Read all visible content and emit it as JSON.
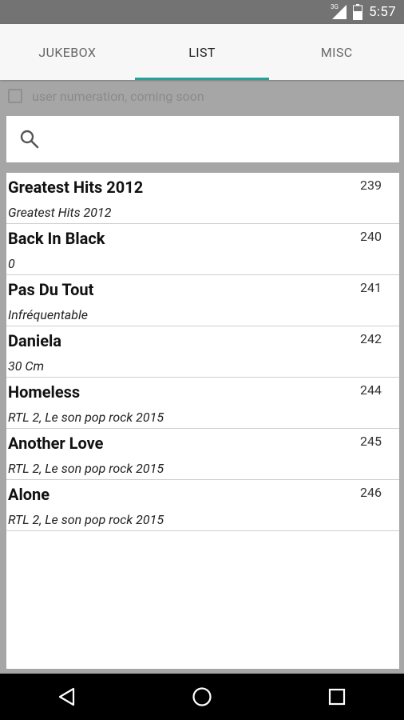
{
  "status_bar": {
    "network": "3G",
    "time": "5:57"
  },
  "tabs": [
    {
      "label": "JUKEBOX",
      "active": false
    },
    {
      "label": "LIST",
      "active": true
    },
    {
      "label": "MISC",
      "active": false
    }
  ],
  "option": {
    "label": "user numeration, coming soon",
    "checked": false
  },
  "search": {
    "value": "",
    "placeholder": "",
    "icon": "search-icon"
  },
  "songs": [
    {
      "title": "Greatest Hits 2012",
      "album": "Greatest Hits 2012",
      "number": "239"
    },
    {
      "title": "Back In Black",
      "album": "0",
      "number": "240"
    },
    {
      "title": "Pas Du Tout",
      "album": "Infréquentable",
      "number": "241"
    },
    {
      "title": "Daniela",
      "album": "30 Cm",
      "number": "242"
    },
    {
      "title": "Homeless",
      "album": "RTL 2, Le son pop rock 2015",
      "number": "244"
    },
    {
      "title": "Another Love",
      "album": "RTL 2, Le son pop rock 2015",
      "number": "245"
    },
    {
      "title": "Alone",
      "album": "RTL 2, Le son pop rock 2015",
      "number": "246"
    }
  ],
  "nav": {
    "back_icon": "back-triangle-icon",
    "home_icon": "home-circle-icon",
    "recents_icon": "recents-square-icon"
  },
  "colors": {
    "accent": "#2aa198",
    "status_bar": "#737373",
    "background": "#a6a6a6"
  }
}
